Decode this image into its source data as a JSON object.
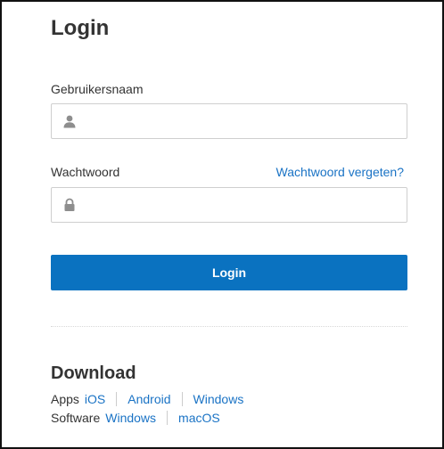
{
  "login": {
    "title": "Login",
    "username_label": "Gebruikersnaam",
    "username_value": "",
    "password_label": "Wachtwoord",
    "password_value": "",
    "forgot_password_link": "Wachtwoord vergeten?",
    "submit_label": "Login"
  },
  "download": {
    "heading": "Download",
    "apps_label": "Apps",
    "apps_links": [
      "iOS",
      "Android",
      "Windows"
    ],
    "software_label": "Software",
    "software_links": [
      "Windows",
      "macOS"
    ]
  },
  "icons": {
    "username_icon": "user-icon",
    "password_icon": "lock-icon"
  },
  "colors": {
    "accent": "#0a72c0",
    "link": "#1a73c5",
    "icon": "#8e8e8e",
    "border": "#cfcfcf"
  }
}
